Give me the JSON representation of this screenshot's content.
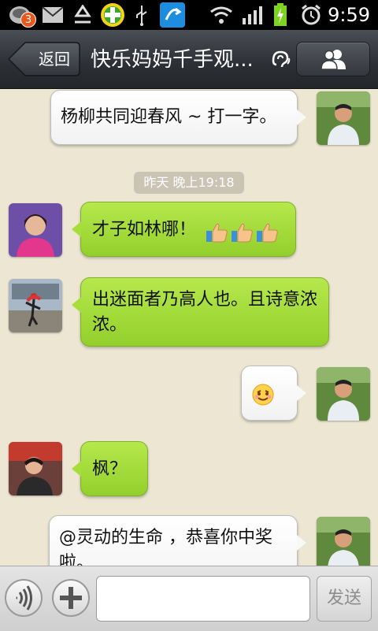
{
  "status_bar": {
    "time": "9:59",
    "notification_count": "3",
    "icons": [
      "notification-app-icon",
      "mail-icon",
      "recycle-icon",
      "plus-app-icon",
      "usb-icon",
      "tool-app-icon",
      "wifi-icon",
      "signal-icon",
      "battery-charging-icon",
      "alarm-icon"
    ]
  },
  "header": {
    "back_label": "返回",
    "title": "快乐妈妈千手观...",
    "earpiece_icon": "earpiece-icon",
    "group_icon": "group-members-icon"
  },
  "chat": {
    "timestamp": "昨天 晚上19:18",
    "messages": [
      {
        "side": "right",
        "text": "杨柳共同迎春风 ~ 打一字。",
        "avatar": "man-in-garden-avatar"
      },
      {
        "side": "left",
        "text": "才子如林哪！",
        "emoji": [
          "thumbs-up-icon",
          "thumbs-up-icon",
          "thumbs-up-icon"
        ],
        "avatar": "woman-pink-avatar"
      },
      {
        "side": "left",
        "text": "出迷面者乃高人也。且诗意浓浓。",
        "avatar": "dancer-avatar"
      },
      {
        "side": "right",
        "text": "",
        "emoji": [
          "smiling-face-icon"
        ],
        "avatar": "man-in-garden-avatar"
      },
      {
        "side": "left",
        "text": "枫？",
        "avatar": "woman-indoor-avatar"
      },
      {
        "side": "right",
        "text": "@灵动的生命 ，恭喜你中奖啦。",
        "avatar": "man-in-garden-avatar"
      }
    ]
  },
  "composer": {
    "input_value": "",
    "input_placeholder": "",
    "send_label": "发送",
    "voice_icon": "voice-icon",
    "add_icon": "plus-icon"
  },
  "colors": {
    "green_bubble": "#a6df3c",
    "white_bubble": "#ffffff",
    "chat_background": "#ede6d2",
    "title_bar": "#2c2f34"
  }
}
